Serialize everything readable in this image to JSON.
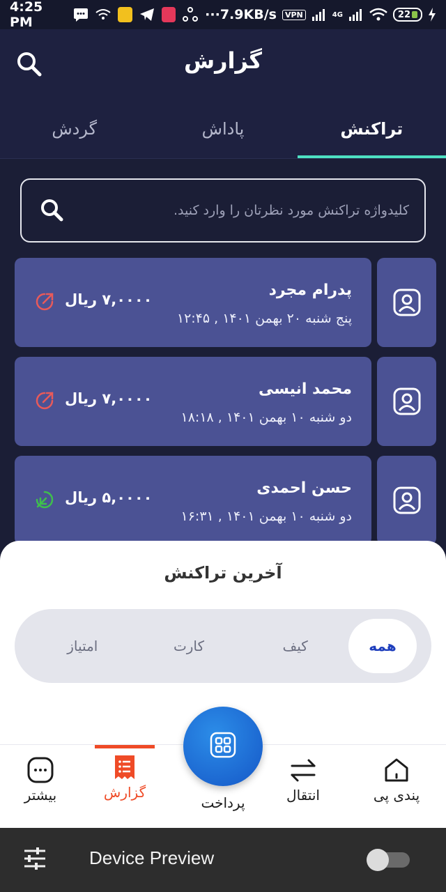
{
  "status_bar": {
    "time": "4:25 PM",
    "net_speed": "7.9KB/s",
    "vpn": "VPN",
    "network": "4G",
    "battery": "22",
    "more": "···"
  },
  "header": {
    "title": "گزارش"
  },
  "tabs": [
    {
      "label": "تراکنش",
      "active": true
    },
    {
      "label": "پاداش",
      "active": false
    },
    {
      "label": "گردش",
      "active": false
    }
  ],
  "search": {
    "placeholder": "کلیدواژه تراکنش مورد نظرتان را وارد کنید."
  },
  "transactions": [
    {
      "name": "پدرام مجرد",
      "date": "پنج شنبه ۲۰ بهمن ۱۴۰۱ , ۱۲:۴۵",
      "amount": "۷,۰۰۰۰ ریال",
      "direction": "outgoing"
    },
    {
      "name": "محمد انیسی",
      "date": "دو شنبه ۱۰ بهمن ۱۴۰۱ , ۱۸:۱۸",
      "amount": "۷,۰۰۰۰ ریال",
      "direction": "outgoing"
    },
    {
      "name": "حسن احمدی",
      "date": "دو شنبه ۱۰ بهمن ۱۴۰۱ , ۱۶:۳۱",
      "amount": "۵,۰۰۰۰ ریال",
      "direction": "incoming"
    }
  ],
  "sheet": {
    "title": "آخرین تراکنش",
    "filters": [
      {
        "label": "همه",
        "active": true
      },
      {
        "label": "کیف",
        "active": false
      },
      {
        "label": "کارت",
        "active": false
      },
      {
        "label": "امتیاز",
        "active": false
      }
    ]
  },
  "bottom_nav": {
    "items": [
      {
        "label": "پندی پی",
        "icon": "home-icon"
      },
      {
        "label": "انتقال",
        "icon": "transfer-icon"
      },
      {
        "label": "گزارش",
        "icon": "receipt-icon",
        "active": true
      },
      {
        "label": "بیشتر",
        "icon": "more-icon"
      }
    ],
    "fab_label": "پرداخت"
  },
  "device_preview": {
    "label": "Device Preview",
    "enabled": false
  },
  "colors": {
    "background": "#1b1e36",
    "card": "#4b5294",
    "tab_indicator": "#4ee0c2",
    "active_nav": "#ef4b27",
    "outgoing": "#e85a5a",
    "incoming": "#3fbf4c",
    "fab": "#1f6ad8"
  }
}
